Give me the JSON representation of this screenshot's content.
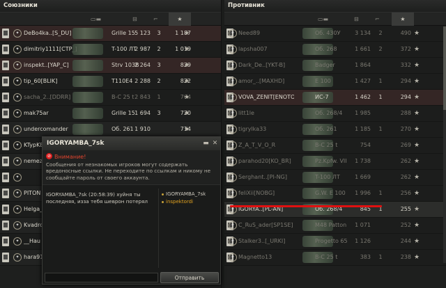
{
  "allies": {
    "title": "Союзники",
    "rows": [
      {
        "name": "DeBo4ka..[S_DU]",
        "vehicle": "Grille 15",
        "rating": "5 123",
        "frags": "3",
        "points": "1 187",
        "state": "red"
      },
      {
        "name": "dimitriy1111[CTP_]",
        "vehicle": "T-100 ЛТ",
        "rating": "2 987",
        "frags": "2",
        "points": "1 019",
        "state": "normal"
      },
      {
        "name": "inspekt..[YAP_C]",
        "vehicle": "Strv 103B",
        "rating": "2 264",
        "frags": "3",
        "points": "829",
        "state": "red"
      },
      {
        "name": "tip_60[BLIK]",
        "vehicle": "T110E4",
        "rating": "2 288",
        "frags": "2",
        "points": "822",
        "state": "normal"
      },
      {
        "name": "sacha_2..[DDRR]",
        "vehicle": "B-C 25 t",
        "rating": "2 843",
        "frags": "1",
        "points": "764",
        "state": "dead"
      },
      {
        "name": "mak75ar",
        "vehicle": "Grille 15",
        "rating": "1 694",
        "frags": "3",
        "points": "720",
        "state": "normal"
      },
      {
        "name": "undercomander",
        "vehicle": "Об. 261",
        "rating": "1 910",
        "frags": "",
        "points": "714",
        "state": "normal"
      },
      {
        "name": "KTypKBOв",
        "vehicle": "",
        "rating": "",
        "frags": "",
        "points": "",
        "state": "normal"
      },
      {
        "name": "nemez",
        "vehicle": "",
        "rating": "",
        "frags": "",
        "points": "",
        "state": "normal"
      },
      {
        "name": "",
        "vehicle": "",
        "rating": "",
        "frags": "",
        "points": "",
        "state": "normal"
      },
      {
        "name": "PITON",
        "vehicle": "",
        "rating": "",
        "frags": "",
        "points": "",
        "state": "normal"
      },
      {
        "name": "Helga_",
        "vehicle": "",
        "rating": "",
        "frags": "",
        "points": "",
        "state": "normal"
      },
      {
        "name": "Kvadrokom",
        "vehicle": "",
        "rating": "",
        "frags": "",
        "points": "",
        "state": "normal"
      },
      {
        "name": "__Hau",
        "vehicle": "",
        "rating": "",
        "frags": "",
        "points": "",
        "state": "normal"
      },
      {
        "name": "hara91",
        "vehicle": "",
        "rating": "",
        "frags": "",
        "points": "",
        "state": "normal"
      }
    ]
  },
  "enemies": {
    "title": "Противник",
    "rows": [
      {
        "name": "Need89",
        "vehicle": "Об. 430У",
        "rating": "3 134",
        "frags": "2",
        "points": "490",
        "state": "dead"
      },
      {
        "name": "lapsha007",
        "vehicle": "Об. 268",
        "rating": "1 661",
        "frags": "2",
        "points": "372",
        "state": "dead"
      },
      {
        "name": "Dark_De..[YKT-B]",
        "vehicle": "Badger",
        "rating": "1 864",
        "frags": "",
        "points": "332",
        "state": "dead"
      },
      {
        "name": "amor_..[MAXHD]",
        "vehicle": "E 100",
        "rating": "1 427",
        "frags": "1",
        "points": "294",
        "state": "dead"
      },
      {
        "name": "VOVA_ZENIT[ENOTO]",
        "vehicle": "ИС-7",
        "rating": "1 462",
        "frags": "1",
        "points": "294",
        "state": "red"
      },
      {
        "name": "litt1le",
        "vehicle": "Об. 268/4",
        "rating": "1 985",
        "frags": "",
        "points": "288",
        "state": "dead"
      },
      {
        "name": "tigrylka33",
        "vehicle": "Об. 261",
        "rating": "1 185",
        "frags": "1",
        "points": "270",
        "state": "dead"
      },
      {
        "name": "Z_A_T_V_O_R",
        "vehicle": "B-C 25 t",
        "rating": "754",
        "frags": "",
        "points": "269",
        "state": "dead"
      },
      {
        "name": "parahod20[KO_BR]",
        "vehicle": "Pz.Kpfw. VII",
        "rating": "1 738",
        "frags": "",
        "points": "262",
        "state": "dead"
      },
      {
        "name": "Serghant..[PI-NG]",
        "vehicle": "T-100 ЛТ",
        "rating": "1 669",
        "frags": "",
        "points": "262",
        "state": "dead"
      },
      {
        "name": "feliXii[NOBG]",
        "vehicle": "G.W. E 100",
        "rating": "1 996",
        "frags": "1",
        "points": "256",
        "state": "dead"
      },
      {
        "name": "IGORYA..[PL-AN]",
        "vehicle": "Об. 268/4",
        "rating": "845",
        "frags": "1",
        "points": "255",
        "state": "sel"
      },
      {
        "name": "C_RuS_ader[SP1SE]",
        "vehicle": "M48 Patton",
        "rating": "1 071",
        "frags": "",
        "points": "252",
        "state": "dead"
      },
      {
        "name": "Stalker3..[_URKI]",
        "vehicle": "Progetto 65",
        "rating": "1 126",
        "frags": "",
        "points": "244",
        "state": "dead"
      },
      {
        "name": "Magnetto13",
        "vehicle": "B-C 25 t",
        "rating": "383",
        "frags": "1",
        "points": "238",
        "state": "dead"
      }
    ]
  },
  "chat": {
    "title": "IGORYAMBA_7sk",
    "warning_title": "Внимание!",
    "warning_text": "Сообщения от незнакомых игроков могут содержать вредоносные ссылки. Не переходите по ссылкам и никому не сообщайте пароль от своего аккаунта.",
    "message": "IGORYAMBA_7sk (20:58:39) хуйня ты последняя, изза тебя шеврон потерял",
    "members": [
      "IGORYAMBA_7sk",
      "inspektordi"
    ],
    "send_label": "Отправить",
    "input_value": ""
  },
  "icons": {
    "close": "close-icon",
    "minimize": "minimize-icon",
    "star": "star-icon"
  }
}
